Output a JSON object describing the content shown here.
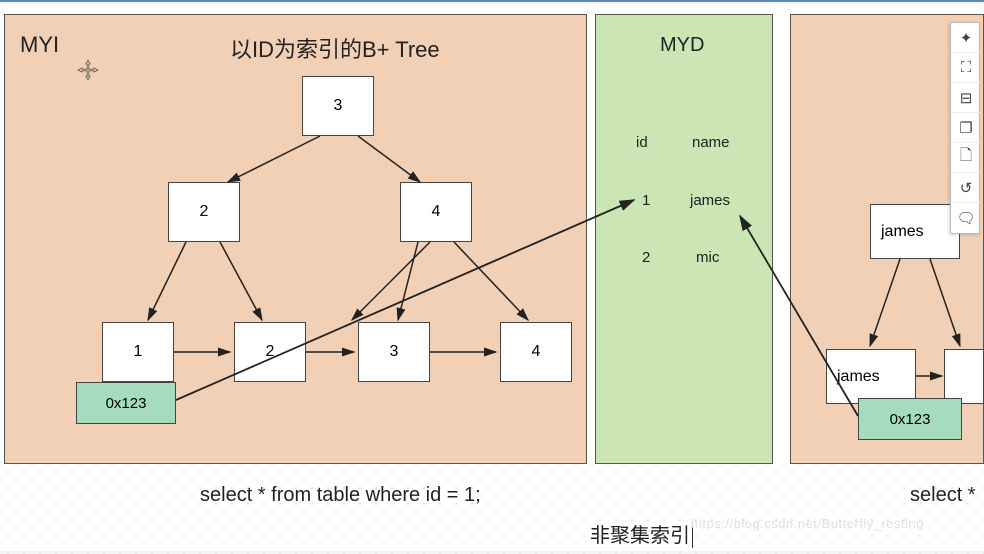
{
  "panels": {
    "myi_label": "MYI",
    "myi_title": "以ID为索引的B+ Tree",
    "myd_label": "MYD"
  },
  "tree": {
    "root": "3",
    "level2_left": "2",
    "level2_right": "4",
    "leaf1": "1",
    "leaf2": "2",
    "leaf3": "3",
    "leaf4": "4",
    "addr": "0x123"
  },
  "myd_table": {
    "col_id": "id",
    "col_name": "name",
    "row1_id": "1",
    "row1_name": "james",
    "row2_id": "2",
    "row2_name": "mic"
  },
  "right_tree": {
    "node_top": "james",
    "node_mid": "james",
    "addr": "0x123"
  },
  "captions": {
    "query": "select * from table where id = 1;",
    "index_type": "非聚集索引",
    "query_partial": "select *"
  },
  "toolbar_icons": {
    "compass": "✦",
    "screen": "⛶",
    "ruler": "⊟",
    "layers": "❐",
    "newfile": "🗋",
    "history": "↺",
    "chat": "🗨"
  },
  "watermark_text": "https://blog.csdn.net/Butterfly_resting"
}
